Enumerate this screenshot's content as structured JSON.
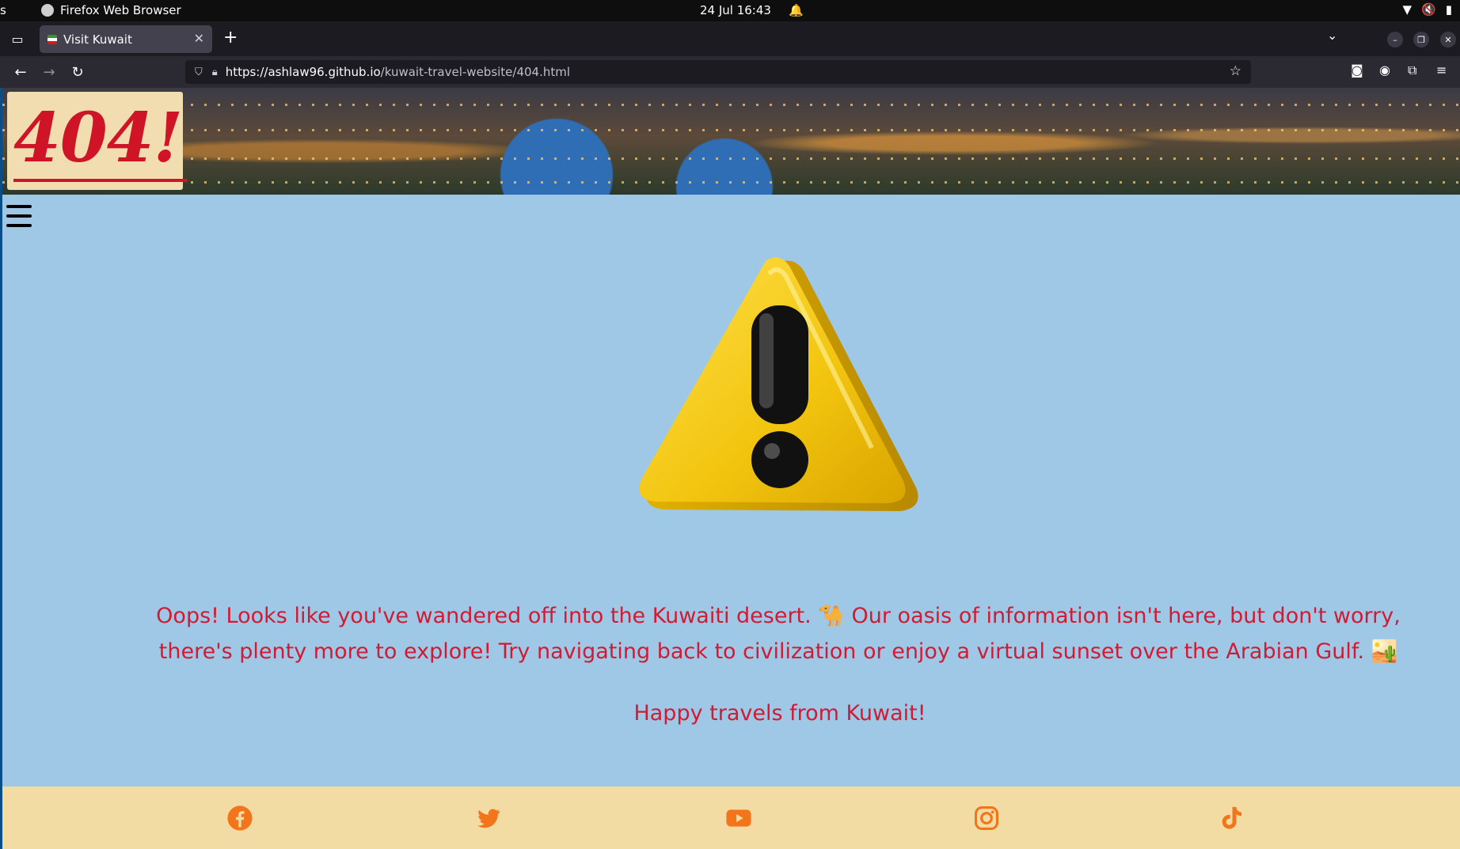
{
  "system": {
    "app_name": "Firefox Web Browser",
    "clipped_label": "s",
    "datetime": "24 Jul  16:43"
  },
  "browser": {
    "tab_title": "Visit Kuwait",
    "url_host": "https://ashlaw96.github.io",
    "url_path": "/kuwait-travel-website/404.html"
  },
  "page": {
    "logo_text": "404!",
    "message": "Oops! Looks like you've wandered off into the Kuwaiti desert. 🐪 Our oasis of information isn't here, but don't worry, there's plenty more to explore! Try navigating back to civilization or enjoy a virtual sunset over the Arabian Gulf. 🏜️",
    "signoff": "Happy travels from Kuwait!"
  },
  "footer": {
    "social_icons": [
      "facebook-icon",
      "twitter-icon",
      "youtube-icon",
      "instagram-icon",
      "tiktok-icon"
    ],
    "icon_color": "#f2751c"
  },
  "colors": {
    "page_bg": "#9ec8e6",
    "text_accent": "#d11a33",
    "footer_bg": "#f2dca4"
  }
}
